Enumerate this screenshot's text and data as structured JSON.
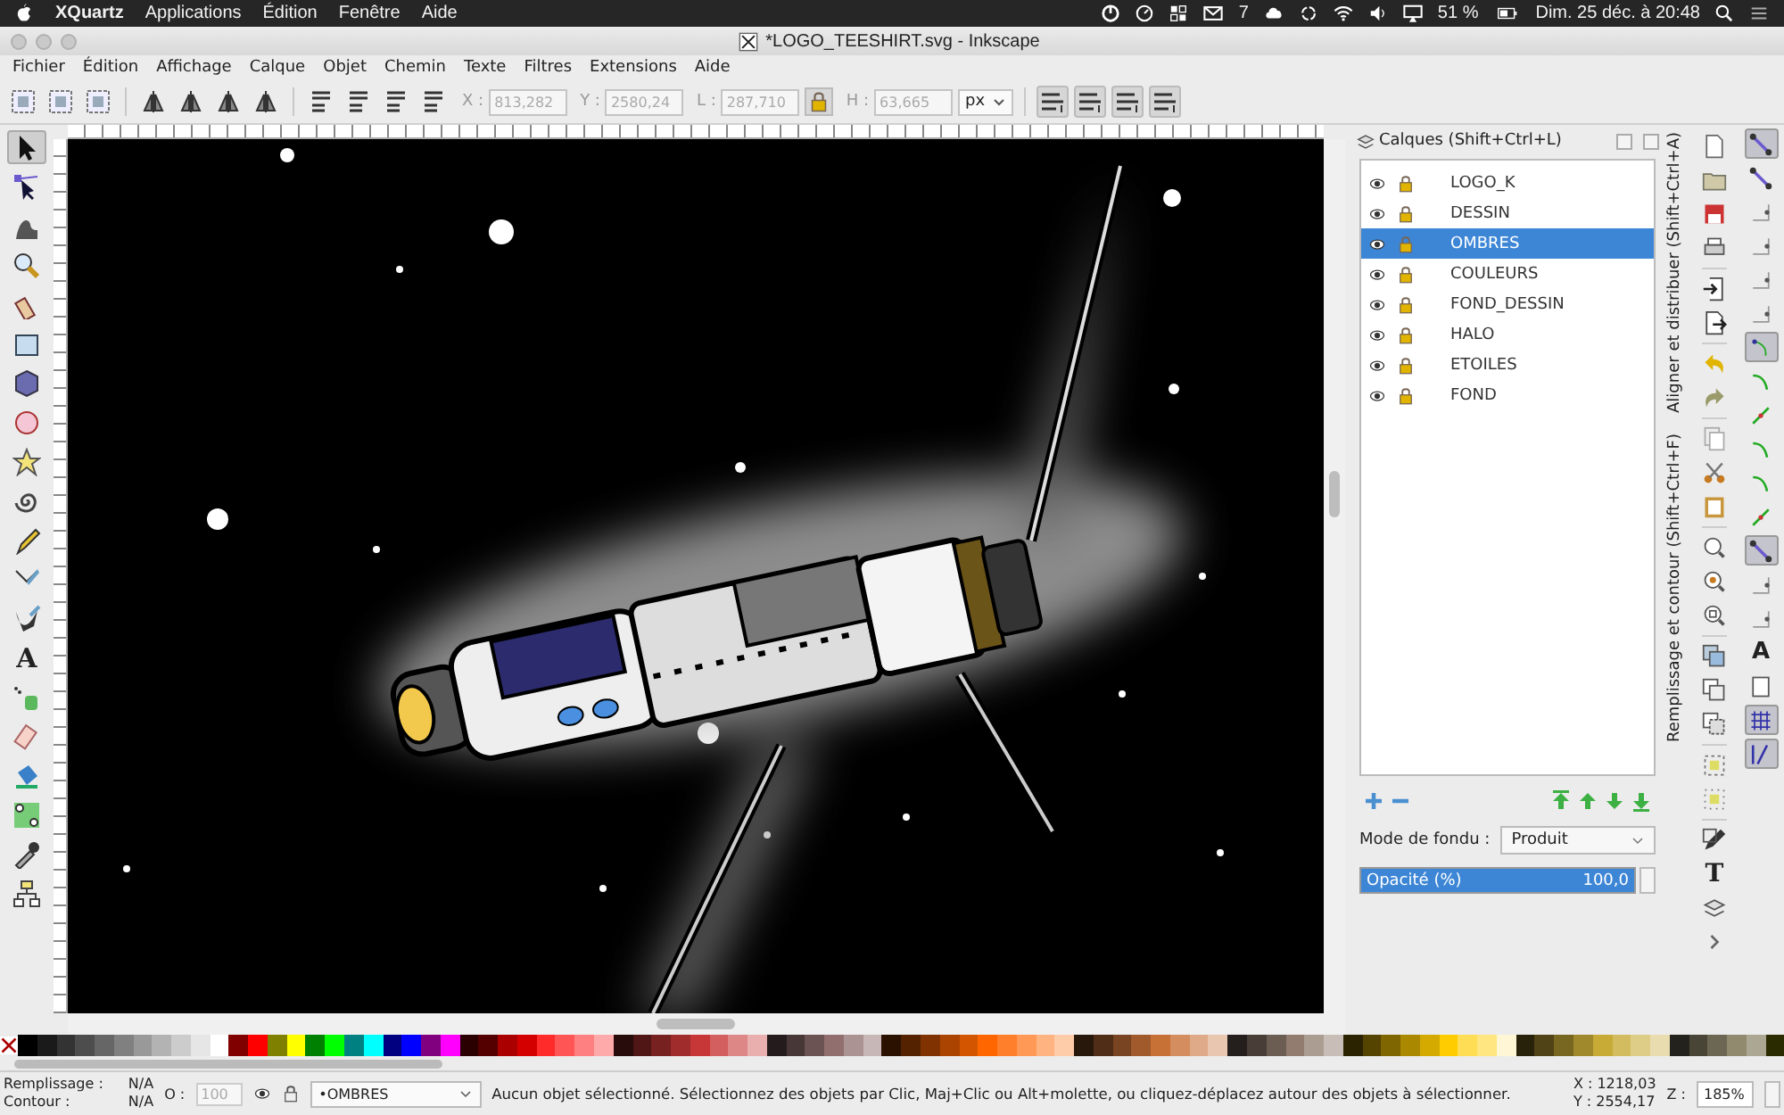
{
  "mac_menubar": {
    "app": "XQuartz",
    "menus": [
      "Applications",
      "Édition",
      "Fenêtre",
      "Aide"
    ],
    "mail_count": "7",
    "battery": "51 %",
    "datetime": "Dim. 25 déc. à 20:48"
  },
  "window": {
    "title": "*LOGO_TEESHIRT.svg - Inkscape"
  },
  "menu": [
    "Fichier",
    "Édition",
    "Affichage",
    "Calque",
    "Objet",
    "Chemin",
    "Texte",
    "Filtres",
    "Extensions",
    "Aide"
  ],
  "toolbar": {
    "fields": [
      {
        "label": "X :",
        "value": "813,282",
        "disabled": true
      },
      {
        "label": "Y :",
        "value": "2580,24",
        "disabled": true
      },
      {
        "label": "L :",
        "value": "287,710",
        "disabled": true
      },
      {
        "label": "H :",
        "value": "63,665",
        "disabled": true
      }
    ],
    "lock_on": true,
    "unit": "px"
  },
  "tools": [
    {
      "selected": true
    },
    {
      "selected": false
    },
    {
      "selected": false
    },
    {
      "selected": false
    },
    {
      "selected": false
    },
    {
      "selected": false
    },
    {
      "selected": false
    },
    {
      "selected": false
    },
    {
      "selected": false
    },
    {
      "selected": false
    },
    {
      "selected": false
    },
    {
      "selected": false
    },
    {
      "selected": false
    },
    {
      "selected": false,
      "glyph": "A"
    },
    {
      "selected": false
    },
    {
      "selected": false
    },
    {
      "selected": false
    },
    {
      "selected": false
    },
    {
      "selected": false
    },
    {
      "selected": false
    }
  ],
  "layers_panel": {
    "title": "Calques (Shift+Ctrl+L)",
    "layers": [
      {
        "name": "LOGO_K",
        "selected": false
      },
      {
        "name": "DESSIN",
        "selected": false
      },
      {
        "name": "OMBRES",
        "selected": true
      },
      {
        "name": "COULEURS",
        "selected": false
      },
      {
        "name": "FOND_DESSIN",
        "selected": false
      },
      {
        "name": "HALO",
        "selected": false
      },
      {
        "name": "ETOILES",
        "selected": false
      },
      {
        "name": "FOND",
        "selected": false
      }
    ],
    "blend_label": "Mode de fondu :",
    "blend_value": "Produit",
    "opacity_label": "Opacité (%)",
    "opacity_value": "100,0",
    "level": 1
  },
  "dock_tabs": [
    "Aligner et distribuer (Shift+Ctrl+A)",
    "Remplissage et contour (Shift+Ctrl+F)"
  ],
  "commands_glyph": "T",
  "snap": [
    {
      "on": true
    },
    {
      "on": false
    },
    {
      "on": false
    },
    {
      "on": false
    },
    {
      "on": false
    },
    {
      "on": false
    },
    {
      "on": true
    },
    {
      "on": false
    },
    {
      "on": false
    },
    {
      "on": false
    },
    {
      "on": false
    },
    {
      "on": false
    },
    {
      "on": true
    },
    {
      "on": false
    },
    {
      "on": false
    },
    {
      "on": false,
      "glyph": "A"
    },
    {
      "on": false
    },
    {
      "on": true
    },
    {
      "on": true
    }
  ],
  "palette": [
    {
      "color": "#000000"
    },
    {
      "color": "#1a1a1a"
    },
    {
      "color": "#333333"
    },
    {
      "color": "#4d4d4d"
    },
    {
      "color": "#666666"
    },
    {
      "color": "#808080"
    },
    {
      "color": "#999999"
    },
    {
      "color": "#b3b3b3"
    },
    {
      "color": "#cccccc"
    },
    {
      "color": "#e6e6e6"
    },
    {
      "color": "#ffffff"
    },
    {
      "color": "#800000"
    },
    {
      "color": "#ff0000"
    },
    {
      "color": "#808000"
    },
    {
      "color": "#ffff00"
    },
    {
      "color": "#008000"
    },
    {
      "color": "#00ff00"
    },
    {
      "color": "#008080"
    },
    {
      "color": "#00ffff"
    },
    {
      "color": "#000080"
    },
    {
      "color": "#0000ff"
    },
    {
      "color": "#800080"
    },
    {
      "color": "#ff00ff"
    },
    {
      "color": "#2b0000"
    },
    {
      "color": "#550000"
    },
    {
      "color": "#aa0000"
    },
    {
      "color": "#d40000"
    },
    {
      "color": "#ff2a2a"
    },
    {
      "color": "#ff5555"
    },
    {
      "color": "#ff8080"
    },
    {
      "color": "#ffaaaa"
    },
    {
      "color": "#280b0b"
    },
    {
      "color": "#501616"
    },
    {
      "color": "#782121"
    },
    {
      "color": "#a02c2c"
    },
    {
      "color": "#c83737"
    },
    {
      "color": "#d35f5f"
    },
    {
      "color": "#de8787"
    },
    {
      "color": "#e9afaf"
    },
    {
      "color": "#241c1c"
    },
    {
      "color": "#483737"
    },
    {
      "color": "#6c5353"
    },
    {
      "color": "#916f6f"
    },
    {
      "color": "#ac9393"
    },
    {
      "color": "#c8b7b7"
    },
    {
      "color": "#2b1100"
    },
    {
      "color": "#552200"
    },
    {
      "color": "#803300"
    },
    {
      "color": "#aa4400"
    },
    {
      "color": "#d45500"
    },
    {
      "color": "#ff6600"
    },
    {
      "color": "#ff7f2a"
    },
    {
      "color": "#ff9955"
    },
    {
      "color": "#ffb380"
    },
    {
      "color": "#ffccaa"
    },
    {
      "color": "#28170b"
    },
    {
      "color": "#502d16"
    },
    {
      "color": "#784421"
    },
    {
      "color": "#a05a2c"
    },
    {
      "color": "#c87137"
    },
    {
      "color": "#d38d5f"
    },
    {
      "color": "#deaa87"
    },
    {
      "color": "#e9c6af"
    },
    {
      "color": "#241f1c"
    },
    {
      "color": "#483e37"
    },
    {
      "color": "#6c5d53"
    },
    {
      "color": "#917c6f"
    },
    {
      "color": "#ac9d93"
    },
    {
      "color": "#c8beb7"
    },
    {
      "color": "#2b2200"
    },
    {
      "color": "#554400"
    },
    {
      "color": "#806600"
    },
    {
      "color": "#aa8800"
    },
    {
      "color": "#d4aa00"
    },
    {
      "color": "#ffcc00"
    },
    {
      "color": "#ffdd55"
    },
    {
      "color": "#ffe680"
    },
    {
      "color": "#fff6d5"
    },
    {
      "color": "#28220b"
    },
    {
      "color": "#504416"
    },
    {
      "color": "#786721"
    },
    {
      "color": "#a0892c"
    },
    {
      "color": "#c8ab37"
    },
    {
      "color": "#d3bc5f"
    },
    {
      "color": "#decd87"
    },
    {
      "color": "#e9ddaf"
    },
    {
      "color": "#24221c"
    },
    {
      "color": "#484537"
    },
    {
      "color": "#6c6753"
    },
    {
      "color": "#918a6f"
    },
    {
      "color": "#aca793"
    },
    {
      "color": "#2b2b00"
    }
  ],
  "status": {
    "fill_label": "Remplissage :",
    "fill_value": "N/A",
    "stroke_label": "Contour :",
    "stroke_value": "N/A",
    "opacity_label": "O :",
    "opacity_value": "100",
    "layer": "•OMBRES",
    "message": "Aucun objet sélectionné. Sélectionnez des objets par Clic, Maj+Clic ou Alt+molette, ou cliquez-déplacez autour des objets à sélectionner.",
    "x": "X : 1218,03",
    "y": "Y : 2554,17",
    "zoom_label": "Z :",
    "zoom_value": "185%"
  }
}
